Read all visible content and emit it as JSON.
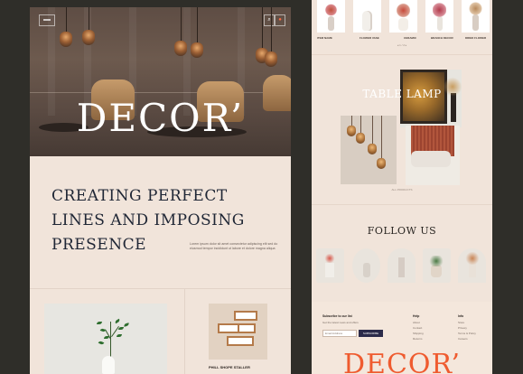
{
  "left_page": {
    "hero": {
      "brand": "DECOR’"
    },
    "heading_lines": [
      "CREATING PERFECT",
      "LINES AND IMPOSING",
      "PRESENCE"
    ],
    "tagline": "Lorem ipsum dolor sit amet consectetur adipiscing elit sed do eiusmod tempor incididunt ut labore et dolore magna aliqua",
    "card_label": "PHILL SHOPE STALLER"
  },
  "right_page": {
    "products": [
      {
        "label": "ITEM NAME"
      },
      {
        "label": "FLOWER VASE"
      },
      {
        "label": "CERAMIC"
      },
      {
        "label": "BRANCH DECOR"
      },
      {
        "label": "DRIED FLOWER"
      }
    ],
    "pager": "◂ 1 / 2 ▸",
    "table_lamp_title": "TABLE LAMP",
    "lamp_caption": "ALL PRODUCTS",
    "follow_title": "FOLLOW US",
    "footer": {
      "subscribe_title": "Subscribe to our list",
      "subscribe_text": "Get the latest news and offers",
      "email_placeholder": "Email Address",
      "subscribe_button": "SUBSCRIBE",
      "col1_title": "Help",
      "col1_items": [
        "About",
        "Contact",
        "Shipping",
        "Returns"
      ],
      "col2_title": "Info",
      "col2_items": [
        "Store",
        "Privacy",
        "Terms & Policy",
        "Careers"
      ]
    },
    "brand": "DECOR’"
  },
  "colors": {
    "page_bg": "#f1e4da",
    "accent": "#ef5b2f",
    "dark_text": "#1f2635"
  }
}
